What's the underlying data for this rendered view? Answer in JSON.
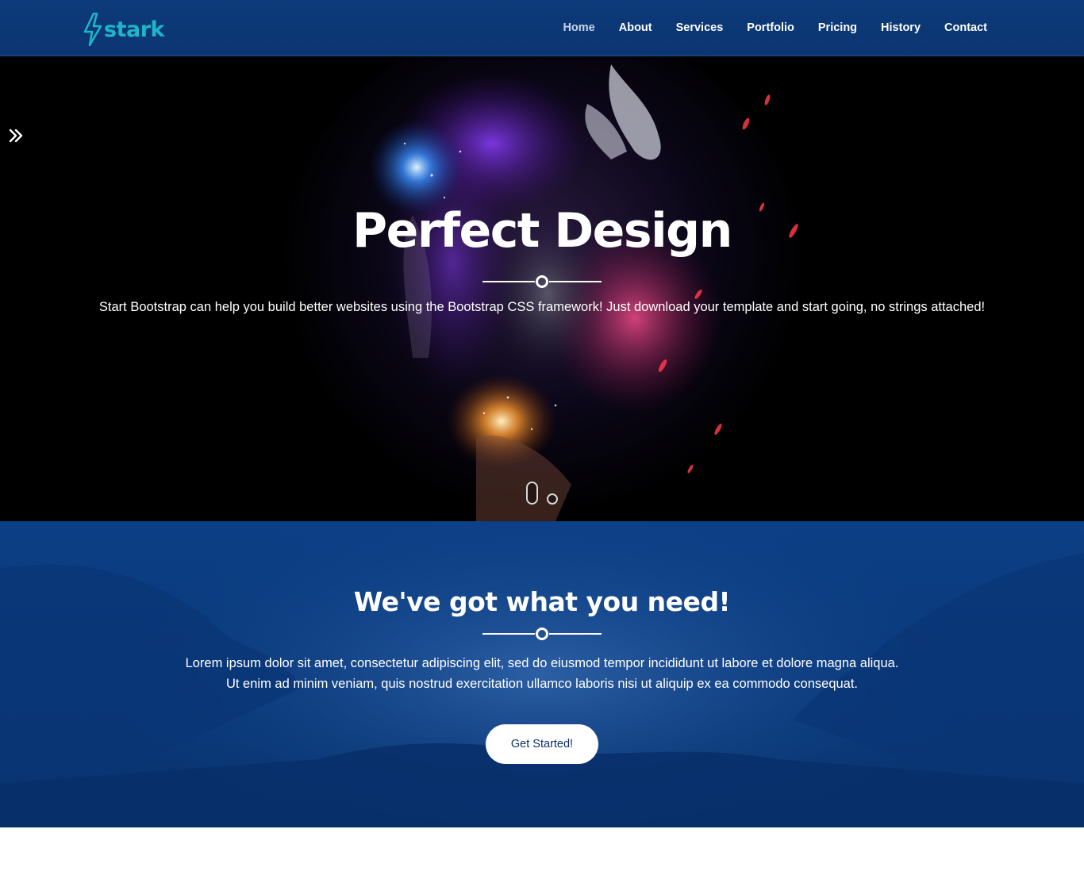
{
  "brand": {
    "name": "stark",
    "logo_icon": "lightning-bolt-icon",
    "color": "#1fb5c9"
  },
  "nav": {
    "items": [
      {
        "label": "Home",
        "active": true
      },
      {
        "label": "About",
        "active": false
      },
      {
        "label": "Services",
        "active": false
      },
      {
        "label": "Portfolio",
        "active": false
      },
      {
        "label": "Pricing",
        "active": false
      },
      {
        "label": "History",
        "active": false
      },
      {
        "label": "Contact",
        "active": false
      }
    ],
    "background": "#0d3a7a"
  },
  "hero": {
    "toggle_icon": "double-chevron-right-icon",
    "title": "Perfect Design",
    "subtitle": "Start Bootstrap can help you build better websites using the Bootstrap CSS framework! Just download your template and start going, no strings attached!",
    "slides": {
      "count": 2,
      "active_index": 0
    }
  },
  "need_section": {
    "title": "We've got what you need!",
    "lines": [
      "Lorem ipsum dolor sit amet, consectetur adipiscing elit, sed do eiusmod tempor incididunt ut labore et dolore magna aliqua.",
      "Ut enim ad minim veniam, quis nostrud exercitation ullamco laboris nisi ut aliquip ex ea commodo consequat."
    ],
    "cta_label": "Get Started!",
    "background": "#0a3b7d"
  }
}
